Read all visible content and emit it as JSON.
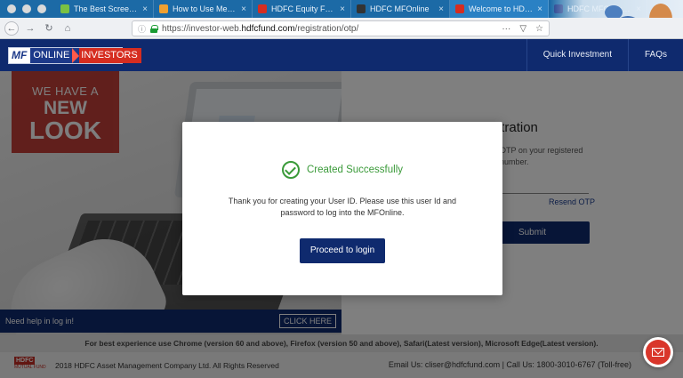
{
  "browser": {
    "tabs": [
      {
        "label": "The Best Screen Captu",
        "fav_color": "#7ac143",
        "active": false
      },
      {
        "label": "How to Use MeSum: A",
        "fav_color": "#f0a030",
        "active": false
      },
      {
        "label": "HDFC Equity Fund – D",
        "fav_color": "#d62d20",
        "active": false
      },
      {
        "label": "HDFC MFOnline",
        "fav_color": "#333333",
        "active": false
      },
      {
        "label": "Welcome to HDFC",
        "fav_color": "#d62d20",
        "active": true
      },
      {
        "label": "HDFC MFOnline Das",
        "fav_color": "#1d3a8a",
        "active": false
      }
    ],
    "url_prefix": "https://investor-web.",
    "url_domain": "hdfcfund.com",
    "url_path": "/registration/otp/",
    "url_menu": "···"
  },
  "header": {
    "logo": {
      "mf": "MF",
      "online": "ONLINE",
      "investors": "INVESTORS"
    },
    "nav": [
      "Quick Investment",
      "FAQs"
    ]
  },
  "banner": {
    "line1": "WE HAVE A",
    "line2": "NEW",
    "line3": "LOOK",
    "help_text": "Need help in log in!",
    "click_here": "CLICK HERE"
  },
  "registration": {
    "title": "User Registration",
    "subtitle_line1": "OTP on your registered",
    "subtitle_line2": "number.",
    "resend": "Resend OTP",
    "submit": "Submit"
  },
  "modal": {
    "title": "Created Successfully",
    "message": "Thank you for creating your User ID. Please use this user Id and password to log into the MFOnline.",
    "button": "Proceed to login",
    "status_color": "#3a9a39"
  },
  "footer": {
    "browser_note": "For best experience use Chrome (version 60 and above), Firefox (version 50 and above), Safari(Latest version), Microsoft Edge(Latest version).",
    "logo_text": "HDFC",
    "logo_sub": "MUTUAL FUND",
    "copyright": "2018 HDFC Asset Management Company Ltd. All Rights Reserved",
    "contact": "Email Us: cliser@hdfcfund.com | Call Us: 1800-3010-6767 (Toll-free)"
  },
  "colors": {
    "brand_navy": "#0f2a6e",
    "brand_red": "#d62d20",
    "tabbar": "#1c6aa6"
  }
}
